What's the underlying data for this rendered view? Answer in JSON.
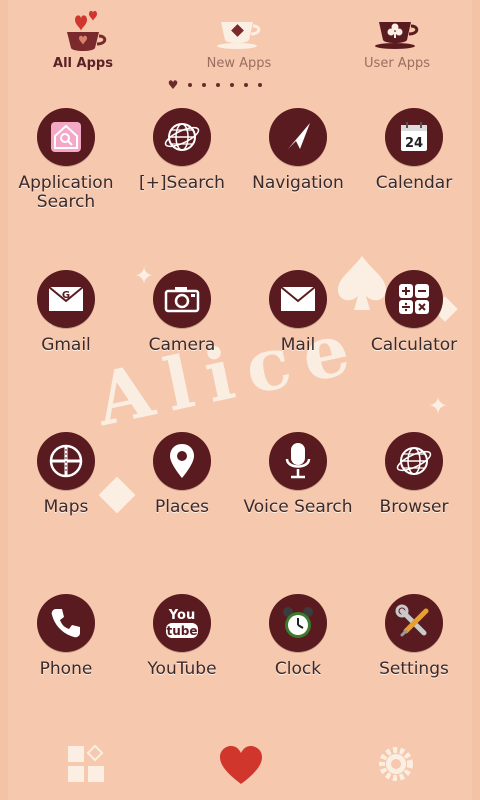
{
  "tabs": [
    {
      "label": "All Apps",
      "active": true,
      "icon": "hearts-teacup-icon"
    },
    {
      "label": "New Apps",
      "active": false,
      "icon": "teacup-diamond-icon"
    },
    {
      "label": "User Apps",
      "active": false,
      "icon": "teacup-club-icon"
    }
  ],
  "page_dots": {
    "count": 7,
    "current": 0
  },
  "background": {
    "word": "Alice"
  },
  "apps": [
    {
      "label": "Application Search",
      "icon": "home-search-icon"
    },
    {
      "label": "[+]Search",
      "icon": "globe-icon"
    },
    {
      "label": "Navigation",
      "icon": "navigation-arrow-icon"
    },
    {
      "label": "Calendar",
      "icon": "calendar-icon",
      "icon_text": "24"
    },
    {
      "label": "Gmail",
      "icon": "envelope-g-icon",
      "icon_text": "G"
    },
    {
      "label": "Camera",
      "icon": "camera-icon"
    },
    {
      "label": "Mail",
      "icon": "envelope-icon"
    },
    {
      "label": "Calculator",
      "icon": "calculator-icon"
    },
    {
      "label": "Maps",
      "icon": "map-road-icon"
    },
    {
      "label": "Places",
      "icon": "location-pin-icon"
    },
    {
      "label": "Voice Search",
      "icon": "microphone-icon"
    },
    {
      "label": "Browser",
      "icon": "globe-icon"
    },
    {
      "label": "Phone",
      "icon": "phone-handset-icon"
    },
    {
      "label": "YouTube",
      "icon": "youtube-icon",
      "icon_text_1": "You",
      "icon_text_2": "tube"
    },
    {
      "label": "Clock",
      "icon": "alarm-clock-icon"
    },
    {
      "label": "Settings",
      "icon": "wrench-screwdriver-icon"
    }
  ],
  "dock": [
    {
      "icon": "app-drawer-icon"
    },
    {
      "icon": "heart-icon"
    },
    {
      "icon": "gear-icon"
    }
  ],
  "colors": {
    "background": "#f6c8ad",
    "icon_circle": "#5a1b20",
    "label": "#3c2a2b",
    "accent_heart": "#d1362d"
  }
}
